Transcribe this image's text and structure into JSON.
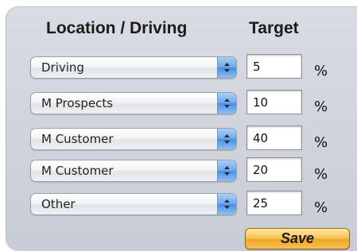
{
  "headers": {
    "location_driving": "Location / Driving",
    "target": "Target"
  },
  "rows": [
    {
      "category": "Driving",
      "target": "5",
      "unit": "%"
    },
    {
      "category": "M Prospects",
      "target": "10",
      "unit": "%"
    },
    {
      "category": "M Customer",
      "target": "40",
      "unit": "%"
    },
    {
      "category": "M Customer",
      "target": "20",
      "unit": "%"
    },
    {
      "category": "Other",
      "target": "25",
      "unit": "%"
    }
  ],
  "actions": {
    "save_label": "Save"
  },
  "colors": {
    "panel": "#d0d4dc",
    "stepper_accent": "#5b97e3",
    "save_button": "#f4b43c"
  },
  "icons": {
    "stepper": "up-down-arrows-icon"
  }
}
